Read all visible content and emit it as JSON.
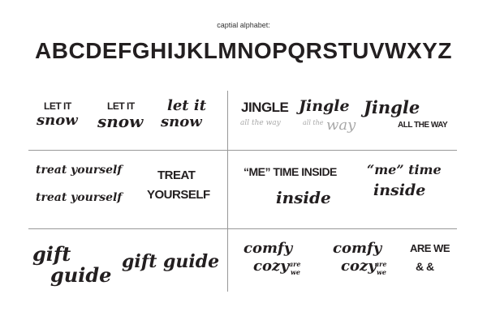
{
  "header": {
    "title": "captial alphabet:",
    "alphabet": "ABCDEFGHIJKLMNOPQRSTUVWXYZ"
  },
  "samples": {
    "let_it_snow": [
      {
        "line1": "LET IT",
        "line2": "snow"
      },
      {
        "line1": "LET IT",
        "line2": "snow"
      },
      {
        "line1": "let it",
        "line2": "snow"
      }
    ],
    "jingle": [
      {
        "line1": "JINGLE",
        "line2": "all the way"
      },
      {
        "line1": "Jingle",
        "line2a": "all the",
        "line2b": "way"
      },
      {
        "line1": "Jingle",
        "line2": "ALL THE WAY"
      }
    ],
    "treat": {
      "script1": "treat yourself",
      "script2": "treat yourself",
      "caps1": "TREAT",
      "caps2": "YOURSELF"
    },
    "me_time": {
      "caps": "“ME” TIME INSIDE",
      "script": "inside",
      "mixed1": "“me” time",
      "mixed2": "inside"
    },
    "gift": {
      "stack1": "gift",
      "stack2": "guide",
      "single": "gift guide"
    },
    "comfy": [
      {
        "line1": "comfy",
        "line2": "cozy",
        "small1": "are",
        "small2": "we"
      },
      {
        "line1": "comfy",
        "line2": "cozy",
        "small1": "are",
        "small2": "we"
      }
    ],
    "are_we": {
      "line1": "ARE WE",
      "line2": "& &"
    }
  }
}
